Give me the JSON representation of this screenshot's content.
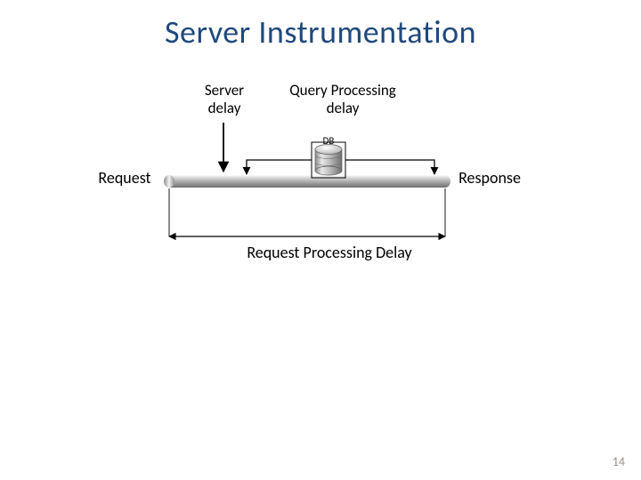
{
  "title": "Server Instrumentation",
  "labels": {
    "server_delay": "Server delay",
    "query_delay": "Query Processing delay",
    "db": "DB",
    "request": "Request",
    "response": "Response",
    "processing_delay": "Request Processing Delay"
  },
  "page_number": "14"
}
